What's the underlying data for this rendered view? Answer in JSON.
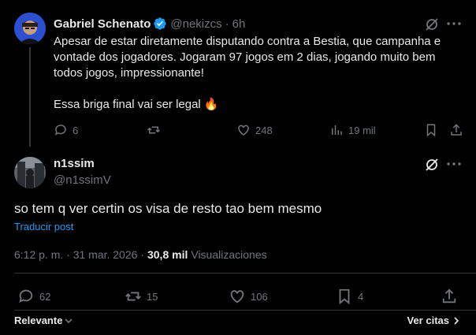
{
  "parent_tweet": {
    "author_name": "Gabriel Schenato",
    "handle": "@nekizcs",
    "separator": "·",
    "time": "6h",
    "text_line1": "Apesar de estar diretamente disputando contra a Bestia, que campanha e vontade dos jogadores. Jogaram 97 jogos em 2 dias, jogando muito bem todos jogos, impressionante!",
    "text_line2": "Essa briga final vai ser legal 🔥",
    "replies": "6",
    "retweets": "",
    "likes": "248",
    "views": "19 mil"
  },
  "reply_tweet": {
    "author_name": "n1ssim",
    "handle": "@n1ssimV",
    "text": "so tem q ver certin os visa de resto tao bem mesmo",
    "translate_label": "Traducir post",
    "timestamp": "6:12 p. m. · 31 mar. 2026 ·",
    "views_count": "30,8 mil",
    "views_label": "Visualizaciones",
    "replies": "62",
    "retweets": "15",
    "likes": "106",
    "bookmarks": "4"
  },
  "footer": {
    "sort_label": "Relevante",
    "quotes_label": "Ver citas"
  },
  "colors": {
    "background": "#000000",
    "text": "#e7e9ea",
    "muted": "#71767b",
    "link": "#1d9bf0",
    "verified": "#1d9bf0",
    "divider": "#2f3336"
  }
}
